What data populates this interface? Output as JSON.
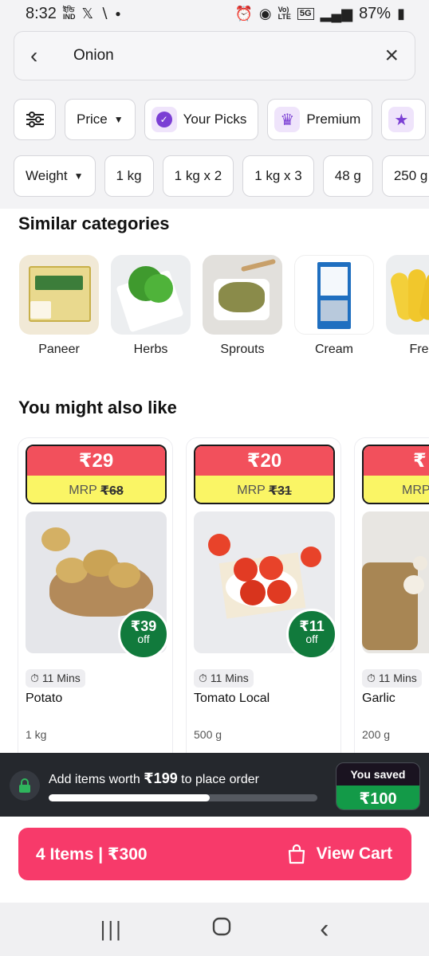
{
  "status": {
    "time": "8:32",
    "left_small": "ইন্ডি\nIND",
    "left_icons": [
      "x-logo-icon",
      "signal-wave-icon",
      "dot-icon"
    ],
    "right_icons": [
      "alarm-icon",
      "hotspot-icon",
      "volte-icon",
      "5g-icon",
      "signal-icon",
      "battery-icon"
    ],
    "volte": "Vo)\nLTE",
    "net": "5G",
    "battery": "87%"
  },
  "search": {
    "query": "Onion",
    "back_icon": "chevron-left-icon",
    "clear_icon": "close-icon"
  },
  "filters_row1": [
    {
      "label": "",
      "icon": "sliders-icon"
    },
    {
      "label": "Price",
      "icon": "chevron-down-icon"
    },
    {
      "label": "Your Picks",
      "icon": "badge-check-icon"
    },
    {
      "label": "Premium",
      "icon": "crown-icon"
    },
    {
      "label": "",
      "icon": "star-icon"
    }
  ],
  "filters_row2": [
    {
      "label": "Weight"
    },
    {
      "label": "1 kg"
    },
    {
      "label": "1 kg x 2"
    },
    {
      "label": "1 kg x 3"
    },
    {
      "label": "48 g"
    },
    {
      "label": "250 g"
    }
  ],
  "similar_title": "Similar categories",
  "categories": [
    {
      "label": "Paneer"
    },
    {
      "label": "Herbs"
    },
    {
      "label": "Sprouts"
    },
    {
      "label": "Cream"
    },
    {
      "label": "Fresh"
    }
  ],
  "also_like_title": "You might also like",
  "products": [
    {
      "price": "₹29",
      "mrp_label": "MRP",
      "mrp": "₹68",
      "off_amount": "₹39",
      "off_label": "off",
      "eta": "11 Mins",
      "name": "Potato",
      "qty": "1 kg"
    },
    {
      "price": "₹20",
      "mrp_label": "MRP",
      "mrp": "₹31",
      "off_amount": "₹11",
      "off_label": "off",
      "eta": "11 Mins",
      "name": "Tomato Local",
      "qty": "500 g"
    },
    {
      "price": "₹",
      "mrp_label": "MRP",
      "mrp": "",
      "off_amount": "",
      "off_label": "",
      "eta": "11 Mins",
      "name": "Garlic",
      "qty": "200 g"
    }
  ],
  "savebar": {
    "msg_prefix": "Add items worth ",
    "msg_amount": "₹199",
    "msg_suffix": " to place order",
    "progress": 0.6,
    "saved_title": "You saved",
    "saved_value": "₹100"
  },
  "cart": {
    "summary": "4 Items | ₹300",
    "action": "View Cart"
  },
  "colors": {
    "accent": "#f73a6a",
    "price_red": "#f2505c",
    "mrp_yellow": "#faf565",
    "off_green": "#117a3c",
    "premium_purple": "#7b3fd4"
  }
}
